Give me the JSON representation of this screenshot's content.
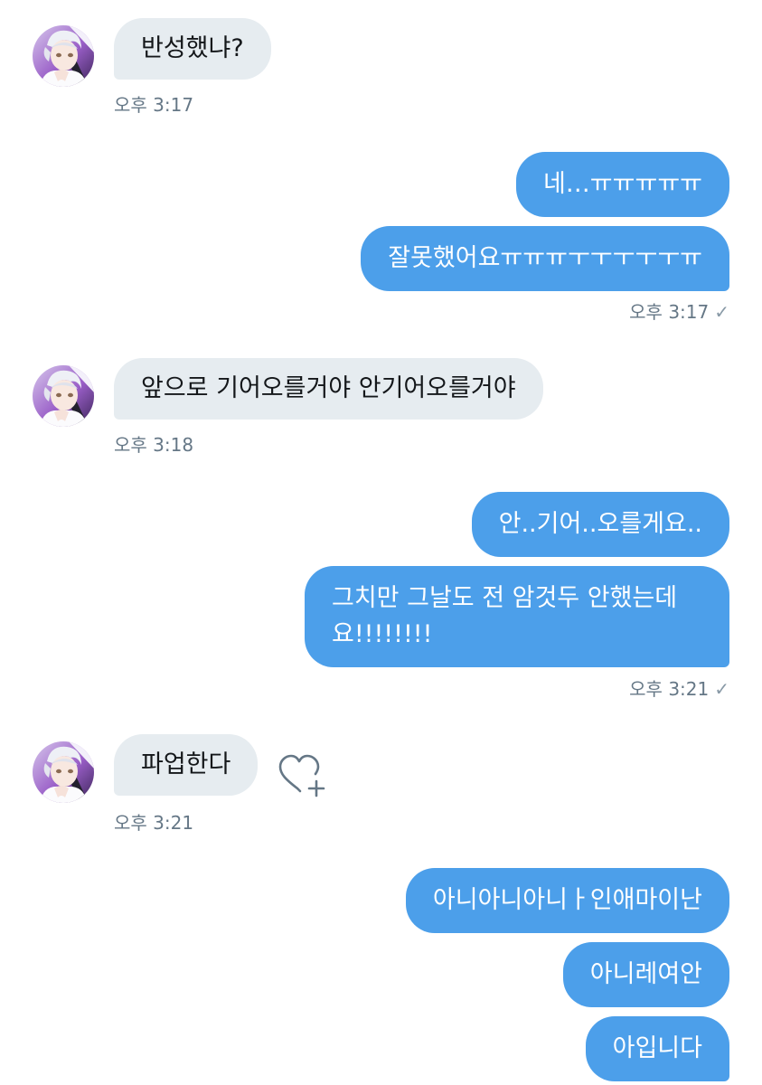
{
  "conversation": {
    "m1": {
      "text": "반성했냐?",
      "time": "오후 3:17"
    },
    "m2": {
      "text": "네…ㅠㅠㅠㅠㅠ"
    },
    "m3": {
      "text": "잘못했어요ㅠㅠㅠㅜㅜㅜㅜㅜㅠ",
      "time": "오후 3:17"
    },
    "m4": {
      "text": "앞으로 기어오를거야 안기어오를거야",
      "time": "오후 3:18"
    },
    "m5": {
      "text": "안..기어..오를게요.."
    },
    "m6": {
      "text": "그치만 그날도 전 암것두 안했는데요!!!!!!!!",
      "time": "오후 3:21"
    },
    "m7": {
      "text": "파업한다",
      "time": "오후 3:21"
    },
    "m8": {
      "text": "아니아니아니ㅏ인애마이난"
    },
    "m9": {
      "text": "아니레여안"
    },
    "m10": {
      "text": "아입니다"
    },
    "read_icon": "checkmark-icon",
    "like_icon": "heart-plus-icon"
  },
  "colors": {
    "outgoing_bubble": "#4c9fea",
    "incoming_bubble": "#e6ecf0",
    "timestamp": "#657786"
  }
}
